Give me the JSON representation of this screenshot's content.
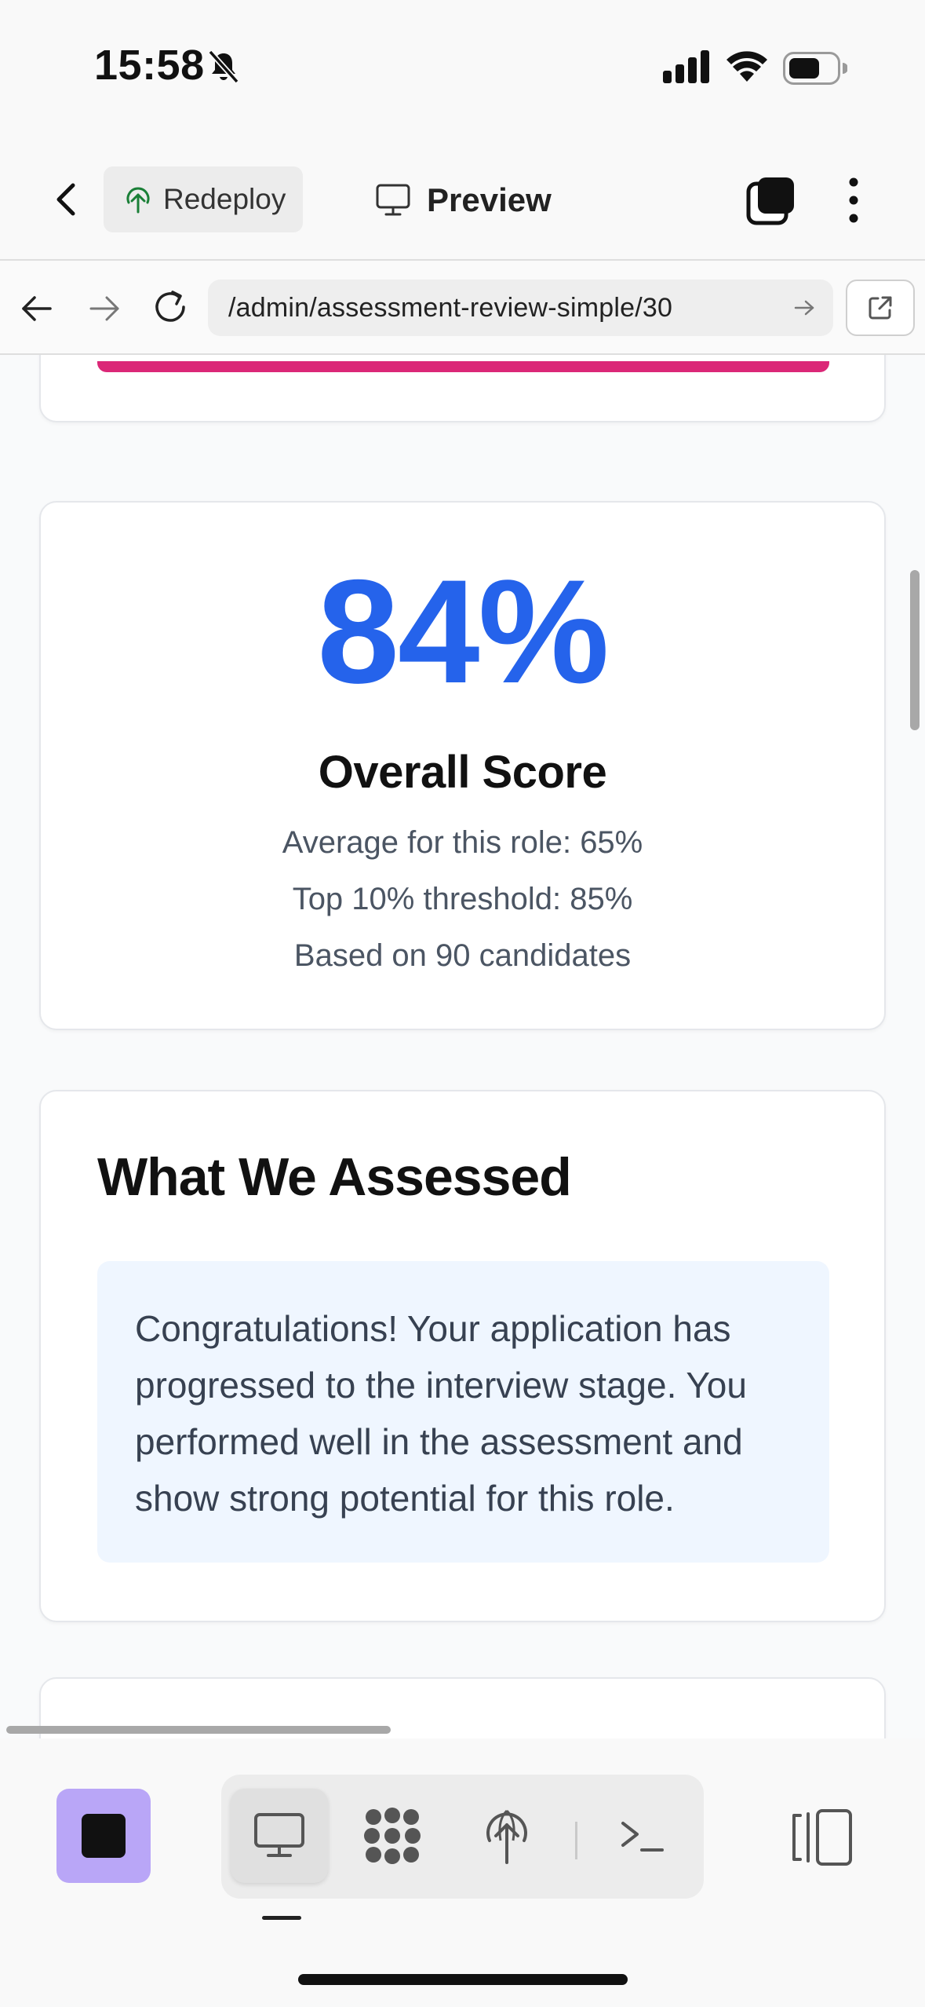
{
  "status_bar": {
    "time": "15:58",
    "icons": [
      "bell-slash-icon",
      "cellular-signal-icon",
      "wifi-icon",
      "battery-icon"
    ]
  },
  "app_toolbar": {
    "back_icon": "chevron-left-icon",
    "redeploy_label": "Redeploy",
    "redeploy_icon": "deploy-tree-icon",
    "preview_label": "Preview",
    "preview_icon": "monitor-icon",
    "tabs_icon": "tabs-stack-icon",
    "more_icon": "vertical-ellipsis-icon"
  },
  "browser_bar": {
    "url": "/admin/assessment-review-simple/30",
    "icons": [
      "arrow-left-icon",
      "arrow-right-icon",
      "reload-icon",
      "url-go-arrow-icon",
      "open-external-icon"
    ]
  },
  "score_card": {
    "value": "84%",
    "title": "Overall Score",
    "lines": [
      "Average for this role: 65%",
      "Top 10% threshold: 85%",
      "Based on 90 candidates"
    ],
    "value_color": "#2563eb"
  },
  "assessed_card": {
    "title": "What We Assessed",
    "message": "Congratulations! Your application has progressed to the interview stage. You performed well in the assessment and show strong potential for this role."
  },
  "accent_colors": {
    "progress_bar": "#db2777",
    "stop_button": "#b9a6f7"
  },
  "bottom_bar": {
    "stop_icon": "stop-square-icon",
    "view_buttons": [
      "monitor-icon",
      "cluster-icon",
      "deploy-tree-icon",
      "terminal-icon"
    ],
    "active_view": "monitor-icon",
    "panel_icon": "split-panel-icon"
  }
}
